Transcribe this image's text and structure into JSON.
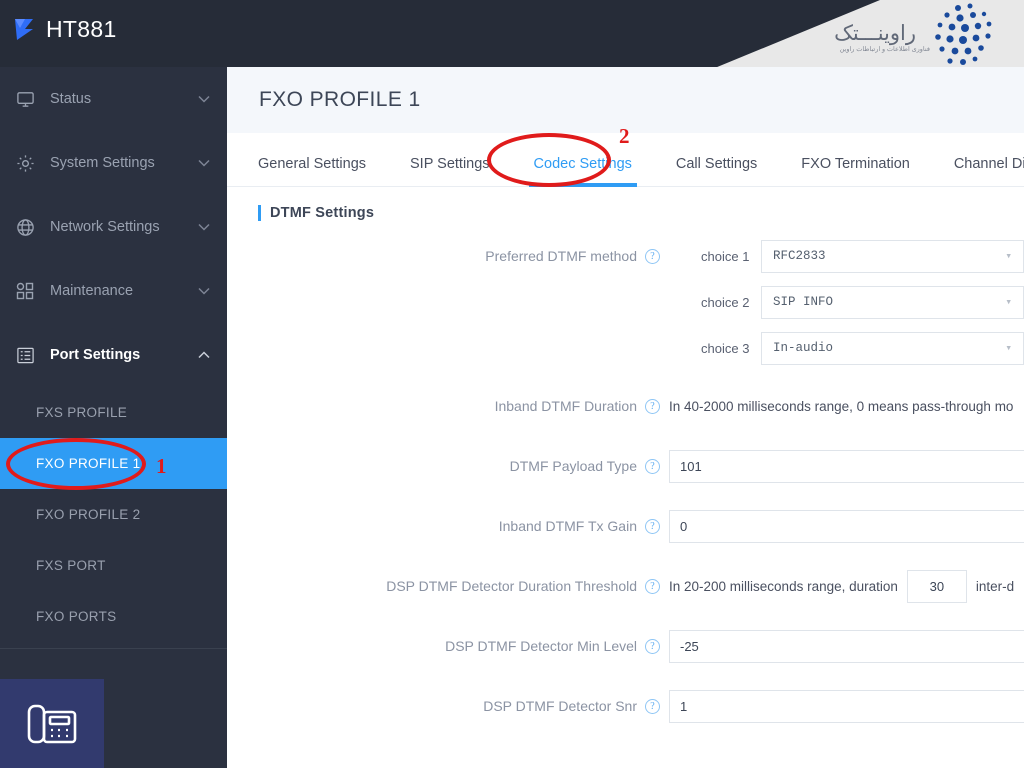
{
  "header": {
    "brand_title": "HT881",
    "brand_logo_icon": "triangle-flag-logo",
    "watermark_text": "راوینـــتک",
    "watermark_subtext": "فناوری اطلاعات و ارتباطات راوین",
    "watermark_dots_icon": "dot-grid-logo"
  },
  "sidebar": {
    "groups": [
      {
        "label": "Status",
        "icon": "monitor-icon",
        "chevron": "chevron-down-icon",
        "open": false
      },
      {
        "label": "System Settings",
        "icon": "gear-icon",
        "chevron": "chevron-down-icon",
        "open": false
      },
      {
        "label": "Network Settings",
        "icon": "globe-icon",
        "chevron": "chevron-down-icon",
        "open": false
      },
      {
        "label": "Maintenance",
        "icon": "grid-squares-icon",
        "chevron": "chevron-down-icon",
        "open": false
      },
      {
        "label": "Port Settings",
        "icon": "ports-list-icon",
        "chevron": "chevron-up-icon",
        "open": true
      }
    ],
    "subitems": [
      {
        "label": "FXS PROFILE",
        "active": false
      },
      {
        "label": "FXO PROFILE 1",
        "active": true
      },
      {
        "label": "FXO PROFILE 2",
        "active": false
      },
      {
        "label": "FXS PORT",
        "active": false
      },
      {
        "label": "FXO PORTS",
        "active": false
      }
    ],
    "phone_tile_icon": "desk-phone-icon",
    "active_color": "#2f9cf4"
  },
  "main": {
    "page_title": "FXO PROFILE 1",
    "tabs": [
      {
        "label": "General Settings",
        "active": false
      },
      {
        "label": "SIP Settings",
        "active": false
      },
      {
        "label": "Codec Settings",
        "active": true
      },
      {
        "label": "Call Settings",
        "active": false
      },
      {
        "label": "FXO Termination",
        "active": false
      },
      {
        "label": "Channel Dialing",
        "active": false
      }
    ],
    "section_title": "DTMF Settings",
    "preferred_dtmf": {
      "label": "Preferred DTMF method",
      "help_icon": "help-circle-icon",
      "choices": [
        {
          "tag": "choice 1",
          "value": "RFC2833",
          "chevron": "chevron-down-icon"
        },
        {
          "tag": "choice 2",
          "value": "SIP INFO",
          "chevron": "chevron-down-icon"
        },
        {
          "tag": "choice 3",
          "value": "In-audio",
          "chevron": "chevron-down-icon"
        }
      ]
    },
    "rows": [
      {
        "label": "Inband DTMF Duration",
        "help_icon": "help-circle-icon",
        "type": "note",
        "note": "In 40-2000 milliseconds range, 0 means pass-through mo"
      },
      {
        "label": "DTMF Payload Type",
        "help_icon": "help-circle-icon",
        "type": "input",
        "value": "101"
      },
      {
        "label": "Inband DTMF Tx Gain",
        "help_icon": "help-circle-icon",
        "type": "input",
        "value": "0"
      },
      {
        "label": "DSP DTMF Detector Duration Threshold",
        "help_icon": "help-circle-icon",
        "type": "note-input-note",
        "note_before": "In 20-200 milliseconds range, duration",
        "value": "30",
        "note_after": "inter-d"
      },
      {
        "label": "DSP DTMF Detector Min Level",
        "help_icon": "help-circle-icon",
        "type": "input",
        "value": "-25"
      },
      {
        "label": "DSP DTMF Detector Snr",
        "help_icon": "help-circle-icon",
        "type": "input",
        "value": "1"
      }
    ]
  },
  "annotations": {
    "color": "#e01b1b",
    "marks": [
      {
        "number": "1",
        "target": "sidebar-item-fxo-profile-1"
      },
      {
        "number": "2",
        "target": "tab-codec-settings"
      }
    ]
  }
}
